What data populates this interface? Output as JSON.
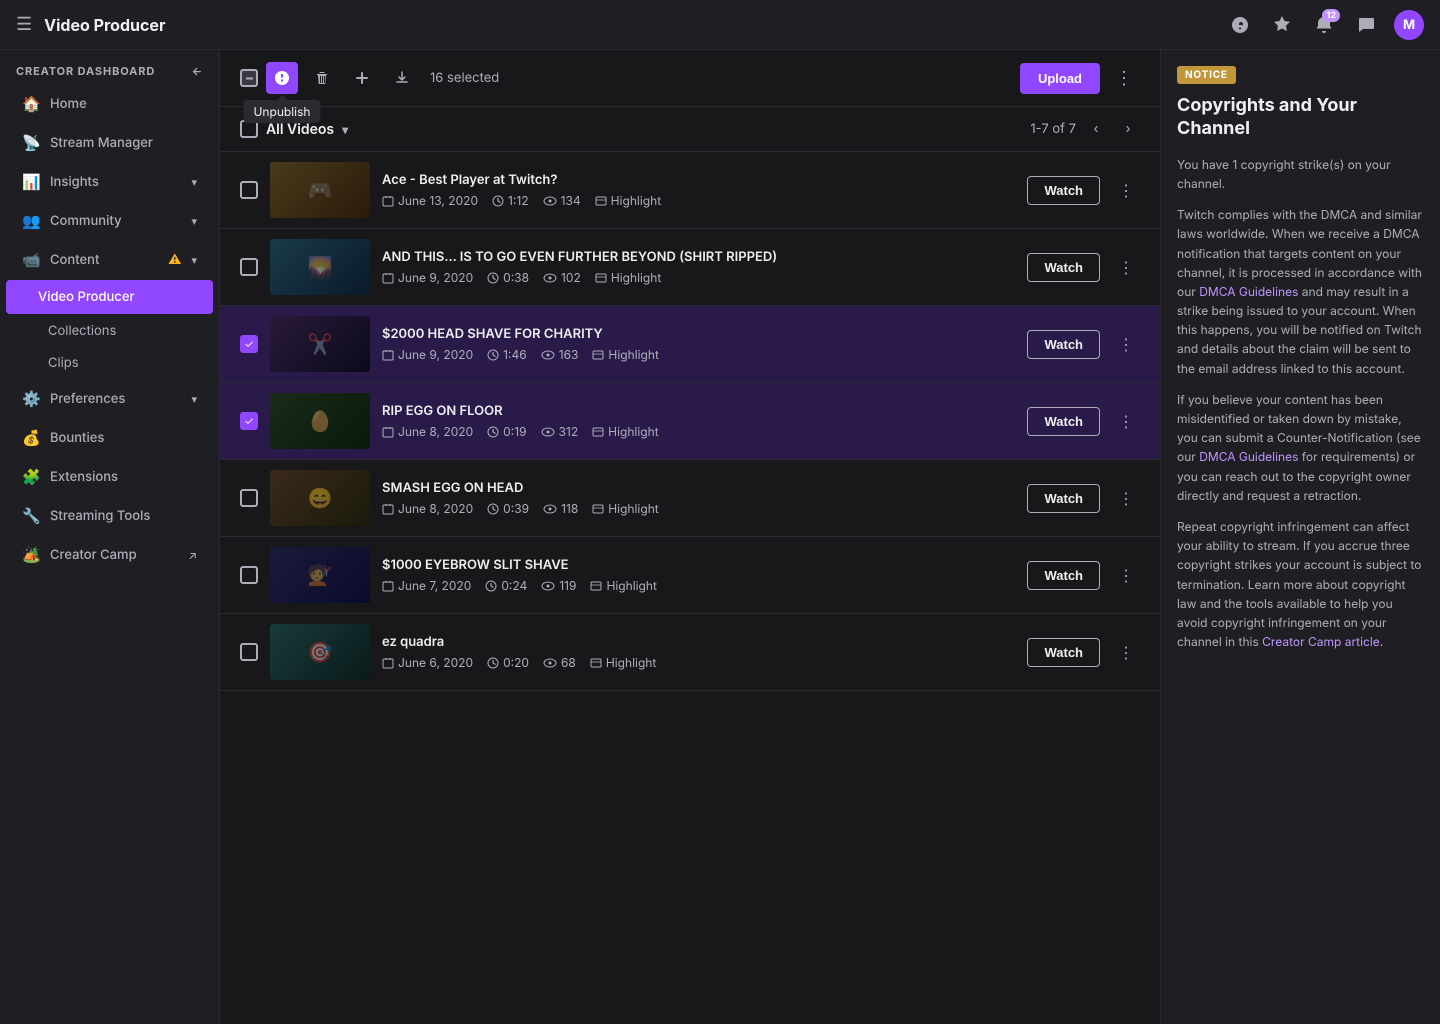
{
  "topnav": {
    "hamburger": "☰",
    "title": "Video Producer",
    "icons": {
      "help": "?",
      "highlight": "⬡",
      "notifications": "🔔",
      "notifications_badge": "12",
      "chat": "💬",
      "avatar_initial": "M"
    }
  },
  "sidebar": {
    "section_label": "CREATOR DASHBOARD",
    "back_icon": "←",
    "items": [
      {
        "id": "home",
        "icon": "🏠",
        "label": "Home"
      },
      {
        "id": "stream-manager",
        "icon": "📡",
        "label": "Stream Manager"
      },
      {
        "id": "insights",
        "icon": "📊",
        "label": "Insights",
        "has_chevron": true
      },
      {
        "id": "community",
        "icon": "👥",
        "label": "Community",
        "has_chevron": true
      },
      {
        "id": "content",
        "icon": "📹",
        "label": "Content",
        "has_chevron": true,
        "has_warning": true
      },
      {
        "id": "video-producer",
        "icon": "",
        "label": "Video Producer",
        "active": true,
        "sub": true
      },
      {
        "id": "collections",
        "icon": "",
        "label": "Collections",
        "sub": true
      },
      {
        "id": "clips",
        "icon": "",
        "label": "Clips",
        "sub": true
      },
      {
        "id": "preferences",
        "icon": "⚙️",
        "label": "Preferences",
        "has_chevron": true
      },
      {
        "id": "bounties",
        "icon": "💰",
        "label": "Bounties"
      },
      {
        "id": "extensions",
        "icon": "🧩",
        "label": "Extensions"
      },
      {
        "id": "streaming-tools",
        "icon": "🔧",
        "label": "Streaming Tools"
      },
      {
        "id": "creator-camp",
        "icon": "🏕️",
        "label": "Creator Camp",
        "external": true
      }
    ]
  },
  "toolbar": {
    "selected_count": "16 selected",
    "unpublish_tooltip": "Unpublish",
    "upload_label": "Upload",
    "more_options": "⋮"
  },
  "video_list": {
    "filter_label": "All Videos",
    "pagination": "1-7 of 7",
    "columns": [
      "checkbox",
      "thumbnail",
      "title",
      "meta",
      "watch",
      "more"
    ],
    "videos": [
      {
        "id": 1,
        "title": "Ace - Best Player at Twitch?",
        "date": "June 13, 2020",
        "duration": "1:12",
        "views": "134",
        "type": "Highlight",
        "selected": false,
        "thumb_class": "thumb-1"
      },
      {
        "id": 2,
        "title": "AND THIS... IS TO GO EVEN FURTHER BEYOND (SHIRT RIPPED)",
        "date": "June 9, 2020",
        "duration": "0:38",
        "views": "102",
        "type": "Highlight",
        "selected": false,
        "thumb_class": "thumb-2"
      },
      {
        "id": 3,
        "title": "$2000 HEAD SHAVE FOR CHARITY",
        "date": "June 9, 2020",
        "duration": "1:46",
        "views": "163",
        "type": "Highlight",
        "selected": true,
        "thumb_class": "thumb-3"
      },
      {
        "id": 4,
        "title": "RIP EGG ON FLOOR",
        "date": "June 8, 2020",
        "duration": "0:19",
        "views": "312",
        "type": "Highlight",
        "selected": true,
        "thumb_class": "thumb-4"
      },
      {
        "id": 5,
        "title": "SMASH EGG ON HEAD",
        "date": "June 8, 2020",
        "duration": "0:39",
        "views": "118",
        "type": "Highlight",
        "selected": false,
        "thumb_class": "thumb-5"
      },
      {
        "id": 6,
        "title": "$1000 EYEBROW SLIT SHAVE",
        "date": "June 7, 2020",
        "duration": "0:24",
        "views": "119",
        "type": "Highlight",
        "selected": false,
        "thumb_class": "thumb-6"
      },
      {
        "id": 7,
        "title": "ez quadra",
        "date": "June 6, 2020",
        "duration": "0:20",
        "views": "68",
        "type": "Highlight",
        "selected": false,
        "thumb_class": "thumb-7"
      }
    ],
    "watch_label": "Watch"
  },
  "notice": {
    "badge": "NOTICE",
    "title": "Copyrights and Your Channel",
    "paragraphs": [
      "You have 1 copyright strike(s) on your channel.",
      "Twitch complies with the DMCA and similar laws worldwide. When we receive a DMCA notification that targets content on your channel, it is processed in accordance with our DMCA Guidelines and may result in a strike being issued to your account. When this happens, you will be notified on Twitch and details about the claim will be sent to the email address linked to this account.",
      "If you believe your content has been misidentified or taken down by mistake, you can submit a Counter-Notification (see our DMCA Guidelines for requirements) or you can reach out to the copyright owner directly and request a retraction.",
      "Repeat copyright infringement can affect your ability to stream. If you accrue three copyright strikes your account is subject to termination. Learn more about copyright law and the tools available to help you avoid copyright infringement on your channel in this Creator Camp article."
    ],
    "links": {
      "dmca_guidelines": "DMCA Guidelines",
      "dmca_guidelines_2": "DMCA Guidelines",
      "creator_camp": "Creator Camp article"
    }
  }
}
